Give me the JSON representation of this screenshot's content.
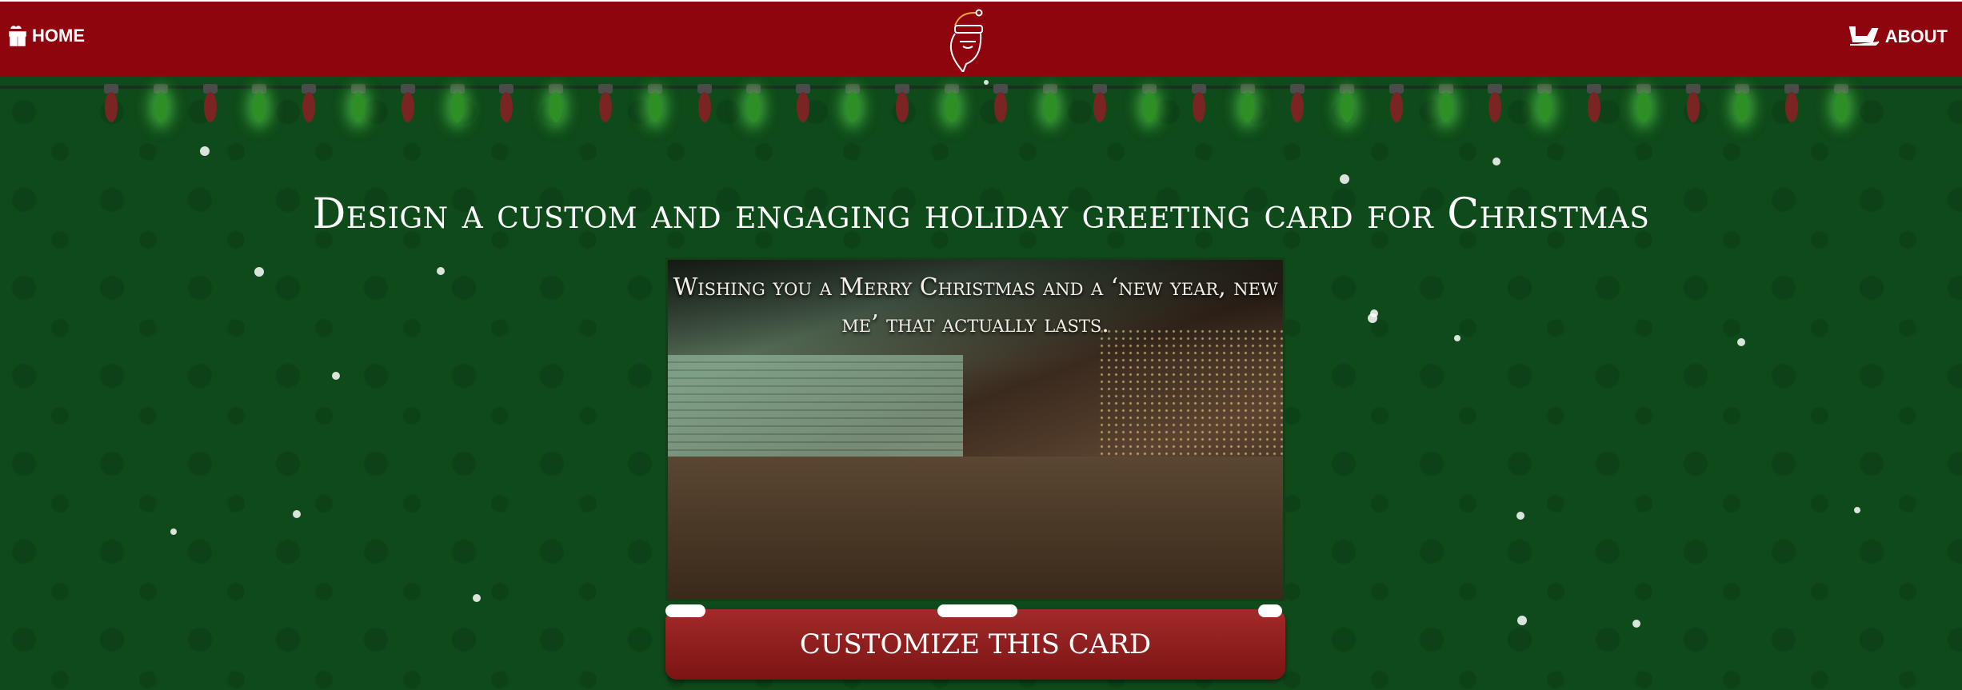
{
  "header": {
    "home_label": "HOME",
    "about_label": "ABOUT",
    "home_icon": "gift-icon",
    "about_icon": "sleigh-icon",
    "logo_icon": "santa-icon"
  },
  "colors": {
    "header": "#8e050e",
    "background": "#0f4a1a",
    "button": "#8e1a1a"
  },
  "page": {
    "title": "Design a custom and engaging holiday greeting card for Christmas"
  },
  "card": {
    "message": "Wishing you a Merry Christmas and a ‘new year, new me’ that actually lasts.",
    "button_label": "CUSTOMIZE THIS CARD"
  }
}
